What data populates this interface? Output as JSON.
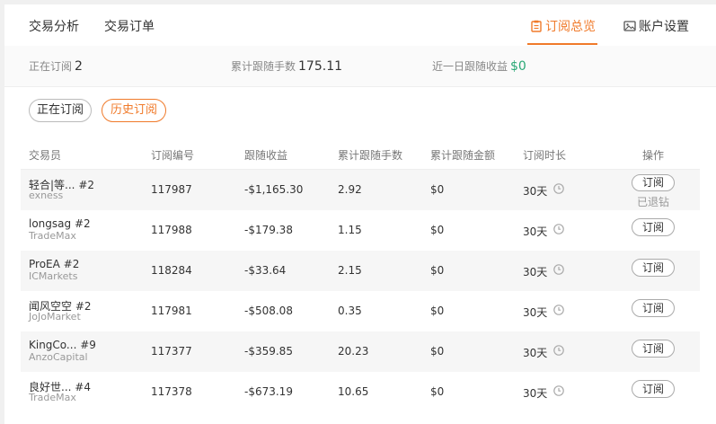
{
  "nav": {
    "left": [
      "交易分析",
      "交易订单"
    ],
    "overview": "订阅总览",
    "settings": "账户设置"
  },
  "stats": {
    "subscribing_label": "正在订阅",
    "subscribing_value": "2",
    "lots_label": "累计跟随手数",
    "lots_value": "175.11",
    "profit_label": "近一日跟随收益",
    "profit_value": "$0"
  },
  "filters": {
    "current": "正在订阅",
    "history": "历史订阅"
  },
  "table": {
    "headers": [
      "交易员",
      "订阅编号",
      "跟随收益",
      "累计跟随手数",
      "累计跟随金额",
      "订阅时长",
      "操作"
    ],
    "rows": [
      {
        "name": "轻合|等...",
        "num": "#2",
        "broker": "exness",
        "id": "117987",
        "profit": "-$1,165.30",
        "lots": "2.92",
        "amount": "$0",
        "duration": "30天",
        "action": "订阅",
        "status": "已退钻"
      },
      {
        "name": "longsag",
        "num": "#2",
        "broker": "TradeMax",
        "id": "117988",
        "profit": "-$179.38",
        "lots": "1.15",
        "amount": "$0",
        "duration": "30天",
        "action": "订阅",
        "status": ""
      },
      {
        "name": "ProEA",
        "num": "#2",
        "broker": "ICMarkets",
        "id": "118284",
        "profit": "-$33.64",
        "lots": "2.15",
        "amount": "$0",
        "duration": "30天",
        "action": "订阅",
        "status": ""
      },
      {
        "name": "闻风空空",
        "num": "#2",
        "broker": "JoJoMarket",
        "id": "117981",
        "profit": "-$508.08",
        "lots": "0.35",
        "amount": "$0",
        "duration": "30天",
        "action": "订阅",
        "status": ""
      },
      {
        "name": "KingCo...",
        "num": "#9",
        "broker": "AnzoCapital",
        "id": "117377",
        "profit": "-$359.85",
        "lots": "20.23",
        "amount": "$0",
        "duration": "30天",
        "action": "订阅",
        "status": ""
      },
      {
        "name": "良好世...",
        "num": "#4",
        "broker": "TradeMax",
        "id": "117378",
        "profit": "-$673.19",
        "lots": "10.65",
        "amount": "$0",
        "duration": "30天",
        "action": "订阅",
        "status": ""
      }
    ]
  },
  "colors": {
    "accent": "#f07a2a",
    "positive": "#2aa876"
  }
}
